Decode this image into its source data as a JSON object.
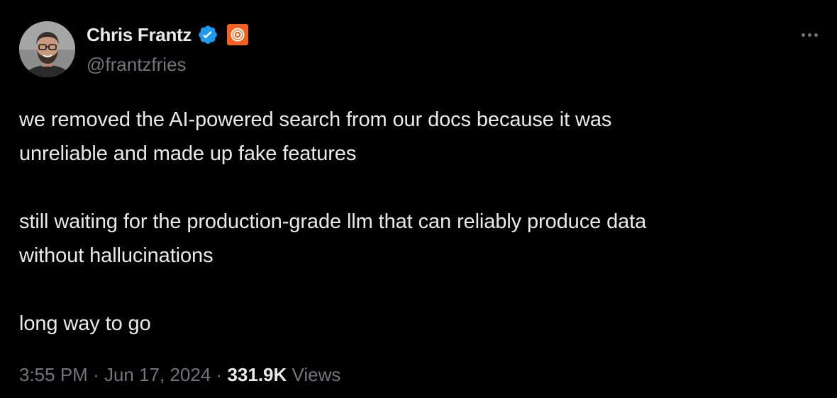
{
  "author": {
    "display_name": "Chris Frantz",
    "handle": "@frantzfries",
    "verified": true,
    "avatar_icon": "avatar-photo",
    "affiliate_badge_icon": "orange-ring-logo-icon"
  },
  "tweet": {
    "paragraphs": [
      {
        "lines": [
          "we removed the AI-powered search from our docs because it was",
          "unreliable and made up fake features"
        ]
      },
      {
        "lines": [
          "still waiting for the production-grade llm that can reliably produce data",
          "without hallucinations"
        ]
      },
      {
        "lines": [
          "long way to go"
        ]
      }
    ]
  },
  "meta": {
    "time": "3:55 PM",
    "separator": "·",
    "date": "Jun 17, 2024",
    "views_count": "331.9K",
    "views_label": "Views"
  },
  "colors": {
    "background": "#000000",
    "primary_text": "#e7e9ea",
    "secondary_text": "#71767b",
    "verified_blue": "#1d9bf0",
    "affiliate_orange": "#f4611e"
  }
}
